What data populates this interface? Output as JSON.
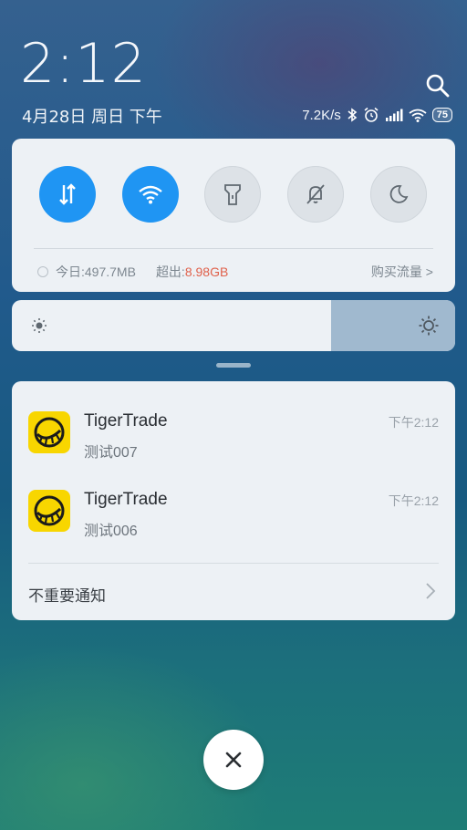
{
  "header": {
    "time": "2:12",
    "date": "4月28日 周日 下午",
    "net_speed": "7.2K/s",
    "battery_level": "75"
  },
  "quick_settings": {
    "toggles": [
      {
        "icon": "mobile-data-icon",
        "state": "on"
      },
      {
        "icon": "wifi-icon",
        "state": "on"
      },
      {
        "icon": "flashlight-icon",
        "state": "off"
      },
      {
        "icon": "mute-icon",
        "state": "off"
      },
      {
        "icon": "dark-mode-icon",
        "state": "off"
      }
    ],
    "usage_today": "今日:497.7MB",
    "over_label": "超出:",
    "over_value": "8.98GB",
    "buy_data": "购买流量 >"
  },
  "brightness": {
    "level": 0.72
  },
  "notifications": {
    "items": [
      {
        "app": "TigerTrade",
        "message": "测试007",
        "time": "下午2:12"
      },
      {
        "app": "TigerTrade",
        "message": "测试006",
        "time": "下午2:12"
      }
    ],
    "unimportant_label": "不重要通知"
  },
  "colors": {
    "accent": "#1f95f3",
    "app_icon_bg": "#f8d600",
    "over_value": "#e0614b"
  }
}
